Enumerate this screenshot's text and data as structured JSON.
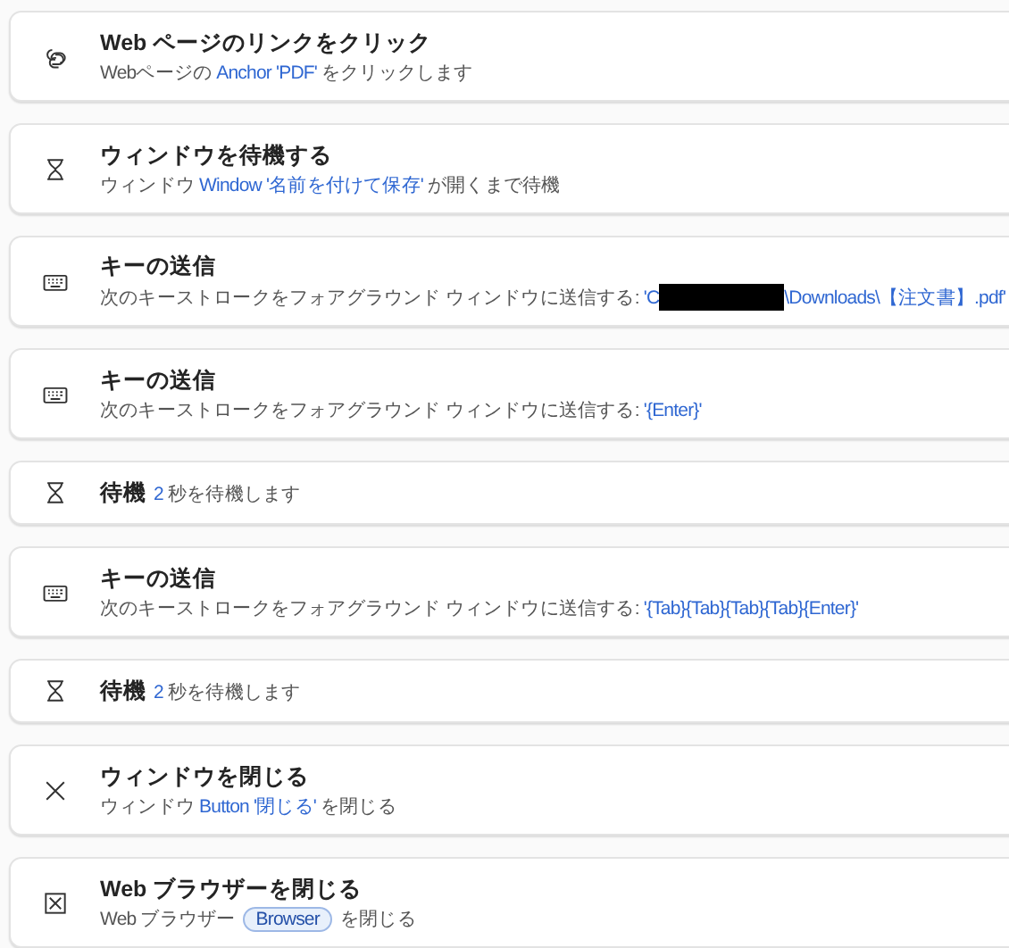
{
  "actions": [
    {
      "kind": "click-link",
      "title": "Web ページのリンクをクリック",
      "description": [
        {
          "kind": "text",
          "text": "Webページの "
        },
        {
          "kind": "value",
          "text": "Anchor 'PDF'"
        },
        {
          "kind": "text",
          "text": " をクリックします"
        }
      ]
    },
    {
      "kind": "wait-window",
      "title": "ウィンドウを待機する",
      "description": [
        {
          "kind": "text",
          "text": "ウィンドウ "
        },
        {
          "kind": "value",
          "text": "Window '名前を付けて保存'"
        },
        {
          "kind": "text",
          "text": " が開くまで待機"
        }
      ]
    },
    {
      "kind": "send-keys",
      "title": "キーの送信",
      "description": [
        {
          "kind": "text",
          "text": "次のキーストロークをフォアグラウンド ウィンドウに送信する: "
        },
        {
          "kind": "value",
          "text": "'C"
        },
        {
          "kind": "redacted"
        },
        {
          "kind": "value",
          "text": "\\Downloads\\【注文書】.pdf'"
        }
      ]
    },
    {
      "kind": "send-keys",
      "title": "キーの送信",
      "description": [
        {
          "kind": "text",
          "text": "次のキーストロークをフォアグラウンド ウィンドウに送信する: "
        },
        {
          "kind": "value",
          "text": "'{Enter}'"
        }
      ]
    },
    {
      "kind": "wait",
      "title": "待機",
      "description": [
        {
          "kind": "value",
          "text": "2"
        },
        {
          "kind": "text",
          "text": " 秒を待機します"
        }
      ]
    },
    {
      "kind": "send-keys",
      "title": "キーの送信",
      "description": [
        {
          "kind": "text",
          "text": "次のキーストロークをフォアグラウンド ウィンドウに送信する: "
        },
        {
          "kind": "value",
          "text": "'{Tab}{Tab}{Tab}{Tab}{Enter}'"
        }
      ]
    },
    {
      "kind": "wait",
      "title": "待機",
      "description": [
        {
          "kind": "value",
          "text": "2"
        },
        {
          "kind": "text",
          "text": " 秒を待機します"
        }
      ]
    },
    {
      "kind": "close-window",
      "title": "ウィンドウを閉じる",
      "description": [
        {
          "kind": "text",
          "text": "ウィンドウ "
        },
        {
          "kind": "value",
          "text": "Button '閉じる'"
        },
        {
          "kind": "text",
          "text": " を閉じる"
        }
      ]
    },
    {
      "kind": "close-browser",
      "title": "Web ブラウザーを閉じる",
      "description": [
        {
          "kind": "text",
          "text": "Web ブラウザー "
        },
        {
          "kind": "pill",
          "text": "Browser"
        },
        {
          "kind": "text",
          "text": " を閉じる"
        }
      ]
    }
  ]
}
